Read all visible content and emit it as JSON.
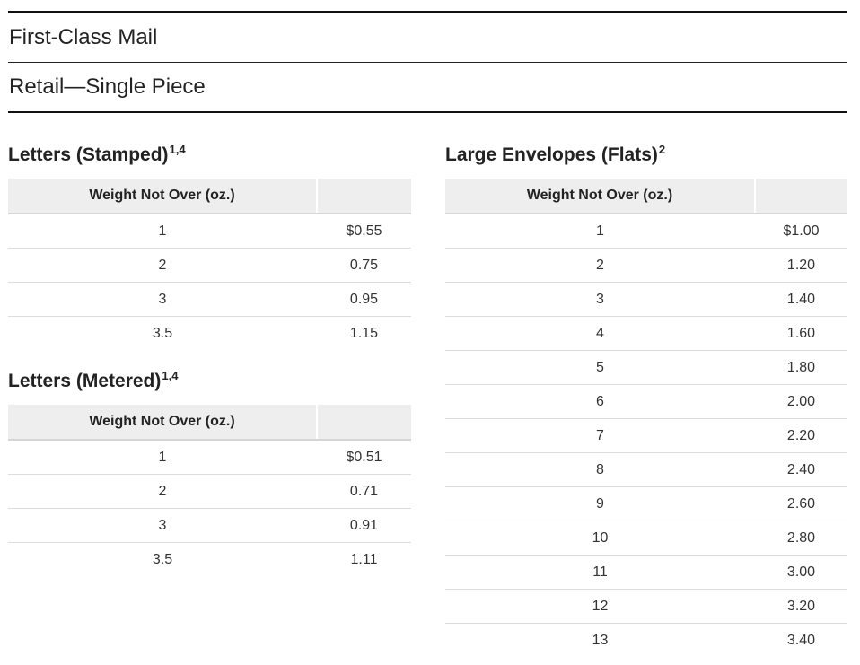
{
  "header": {
    "title": "First-Class Mail",
    "subtitle": "Retail—Single Piece"
  },
  "sections": {
    "letters_stamped": {
      "title": "Letters (Stamped)",
      "footnote": "1,4",
      "col_weight": "Weight Not Over (oz.)",
      "col_price": "",
      "rows": [
        {
          "weight": "1",
          "price": "$0.55"
        },
        {
          "weight": "2",
          "price": "0.75"
        },
        {
          "weight": "3",
          "price": "0.95"
        },
        {
          "weight": "3.5",
          "price": "1.15"
        }
      ]
    },
    "letters_metered": {
      "title": "Letters (Metered)",
      "footnote": "1,4",
      "col_weight": "Weight Not Over (oz.)",
      "col_price": "",
      "rows": [
        {
          "weight": "1",
          "price": "$0.51"
        },
        {
          "weight": "2",
          "price": "0.71"
        },
        {
          "weight": "3",
          "price": "0.91"
        },
        {
          "weight": "3.5",
          "price": "1.11"
        }
      ]
    },
    "large_envelopes": {
      "title": "Large Envelopes (Flats)",
      "footnote": "2",
      "col_weight": "Weight Not Over (oz.)",
      "col_price": "",
      "rows": [
        {
          "weight": "1",
          "price": "$1.00"
        },
        {
          "weight": "2",
          "price": "1.20"
        },
        {
          "weight": "3",
          "price": "1.40"
        },
        {
          "weight": "4",
          "price": "1.60"
        },
        {
          "weight": "5",
          "price": "1.80"
        },
        {
          "weight": "6",
          "price": "2.00"
        },
        {
          "weight": "7",
          "price": "2.20"
        },
        {
          "weight": "8",
          "price": "2.40"
        },
        {
          "weight": "9",
          "price": "2.60"
        },
        {
          "weight": "10",
          "price": "2.80"
        },
        {
          "weight": "11",
          "price": "3.00"
        },
        {
          "weight": "12",
          "price": "3.20"
        },
        {
          "weight": "13",
          "price": "3.40"
        }
      ]
    }
  }
}
